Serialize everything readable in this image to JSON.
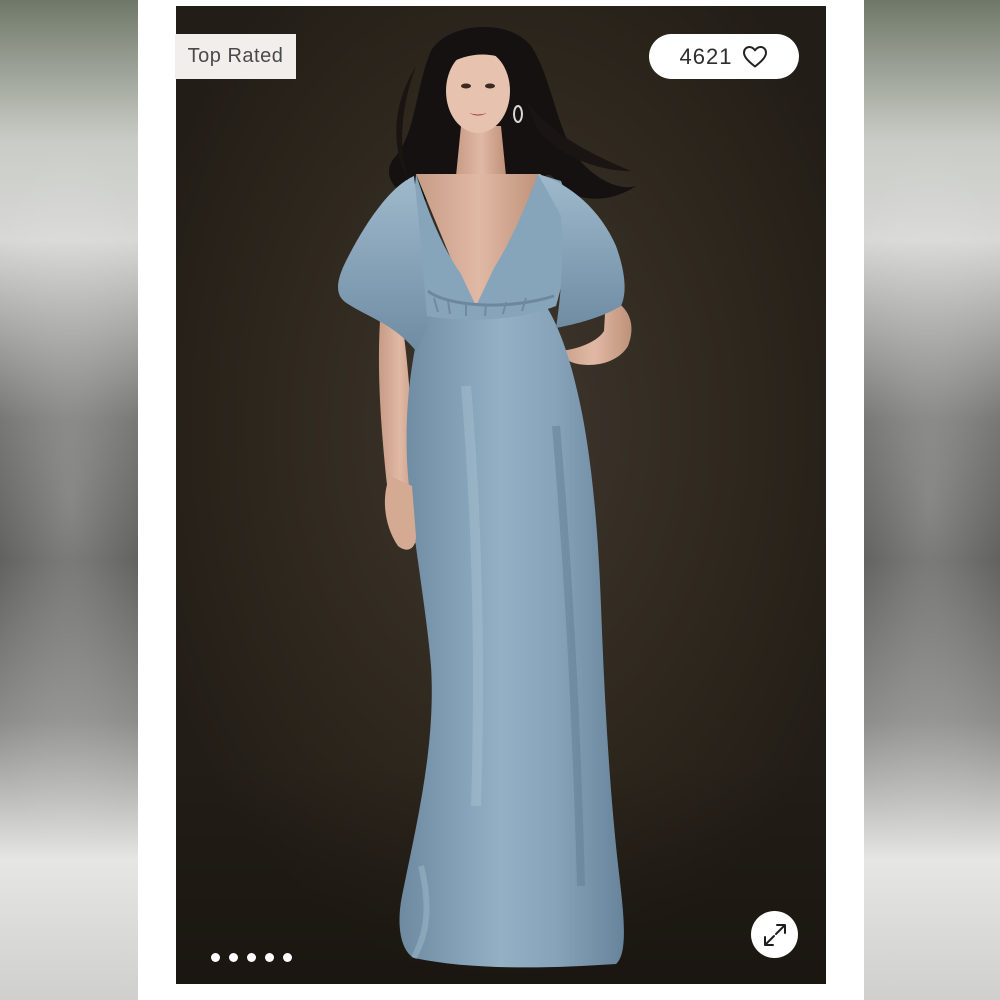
{
  "product_image": {
    "badge": "Top Rated",
    "like_count": "4621",
    "heart_icon": "heart-outline-icon",
    "expand_icon": "expand-arrows-icon",
    "carousel": {
      "slides": 5,
      "active_index": 0
    }
  },
  "colors": {
    "backdrop": "#2b241c",
    "dress": "#7f9db4",
    "badge_background": "#f1eeec",
    "card": "#ffffff"
  }
}
